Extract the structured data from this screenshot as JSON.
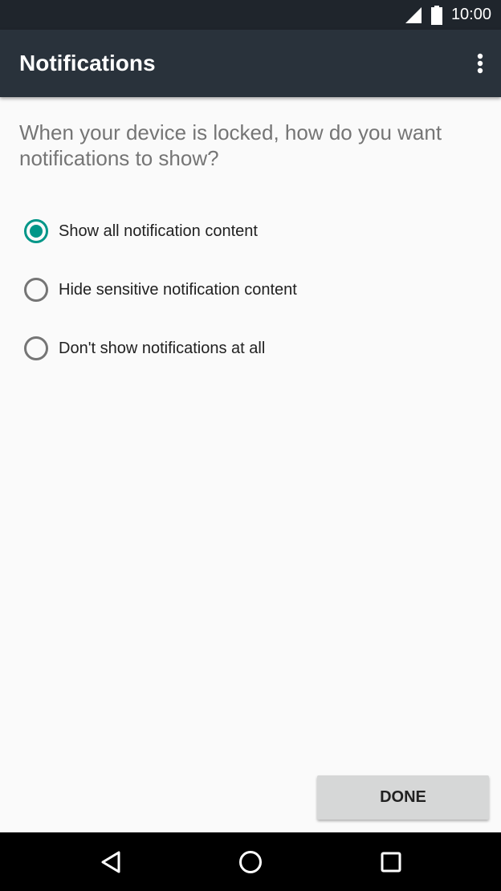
{
  "status_bar": {
    "time": "10:00",
    "icons": [
      "signal-icon",
      "battery-icon"
    ]
  },
  "app_bar": {
    "title": "Notifications",
    "overflow_icon": "more-vert-icon"
  },
  "main": {
    "question": "When your device is locked, how do you want notifications to show?",
    "options": [
      {
        "label": "Show all notification content",
        "selected": true
      },
      {
        "label": "Hide sensitive notification content",
        "selected": false
      },
      {
        "label": "Don't show notifications at all",
        "selected": false
      }
    ],
    "done_label": "DONE"
  },
  "nav_bar": {
    "buttons": [
      "back-icon",
      "home-icon",
      "recents-icon"
    ]
  },
  "colors": {
    "status_bar": "#1f252c",
    "app_bar": "#29323b",
    "accent": "#009688",
    "background": "#fafafa",
    "button": "#d6d7d7"
  }
}
